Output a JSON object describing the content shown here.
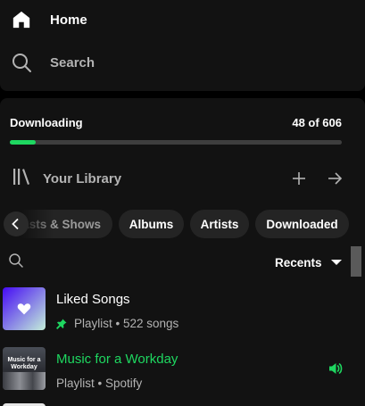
{
  "nav": {
    "home_label": "Home",
    "search_label": "Search"
  },
  "downloading": {
    "label": "Downloading",
    "count_text": "48 of 606",
    "progress": 0.0792
  },
  "library": {
    "title": "Your Library",
    "create_icon": "plus-icon",
    "expand_icon": "arrow-right-icon"
  },
  "filters": {
    "chips": [
      "Podcasts & Shows",
      "Albums",
      "Artists",
      "Downloaded"
    ]
  },
  "sort": {
    "label": "Recents"
  },
  "items": [
    {
      "title": "Liked Songs",
      "subtitle": "Playlist • 522 songs",
      "pinned": true,
      "playing": false
    },
    {
      "title": "Music for a Workday",
      "subtitle": "Playlist • Spotify",
      "cover_text": "Music for a Workday",
      "pinned": false,
      "playing": true
    }
  ],
  "colors": {
    "accent": "#1ed760",
    "panel": "#121212",
    "chip": "#242424",
    "muted_text": "#b3b3b3"
  }
}
